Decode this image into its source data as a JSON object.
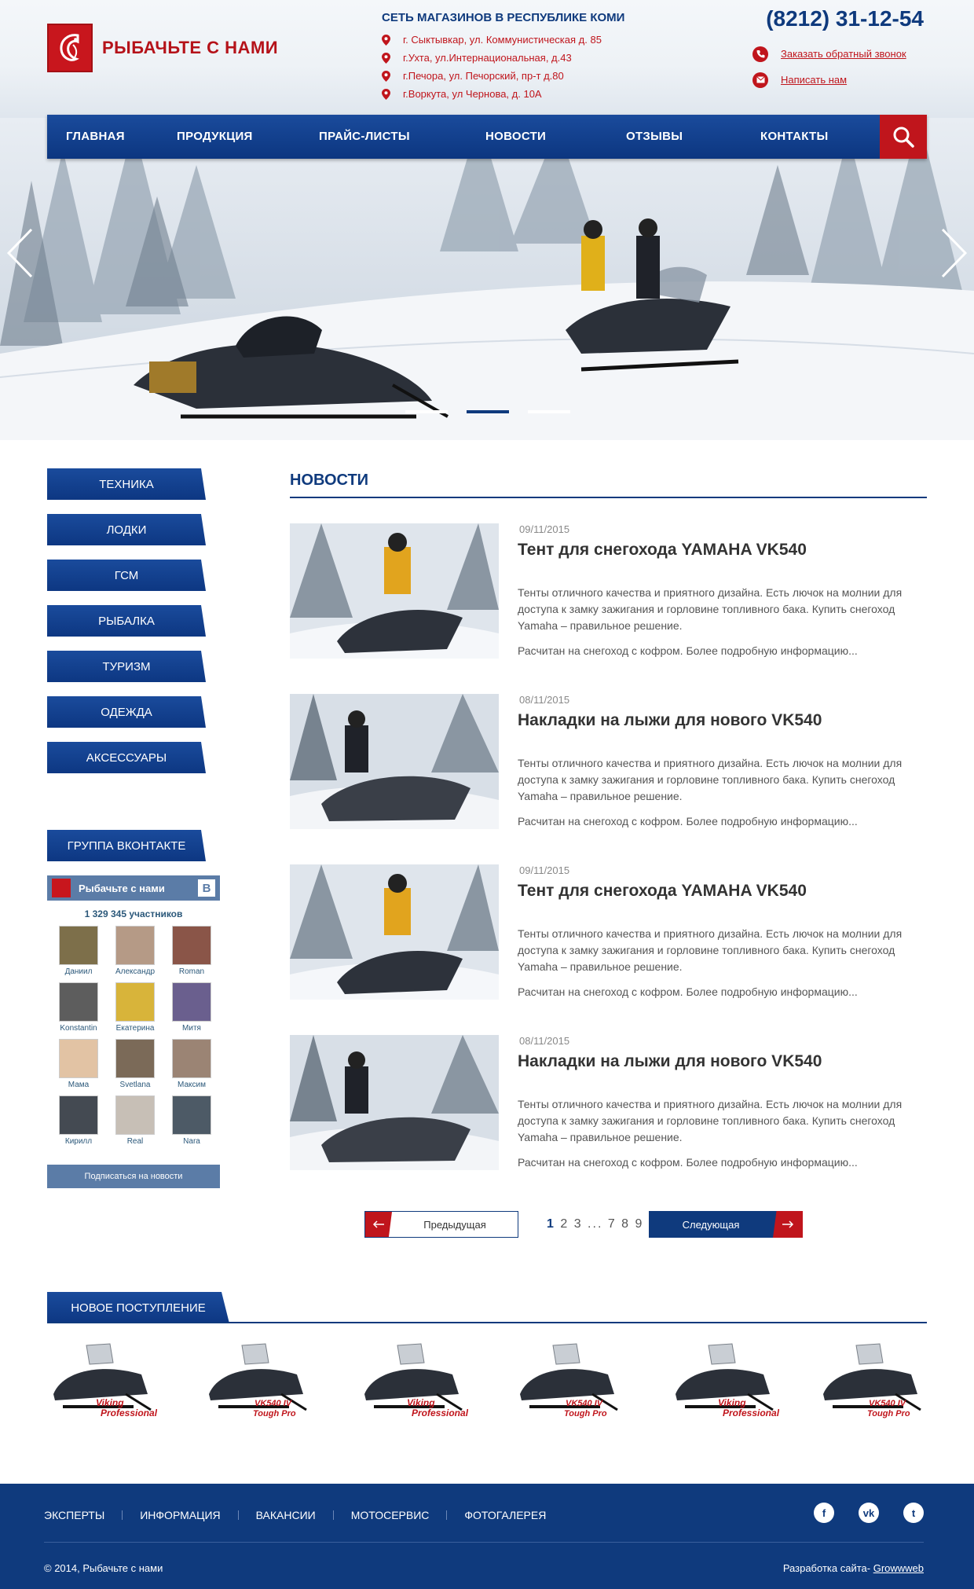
{
  "header": {
    "logo_text": "РЫБАЧЬТЕ С НАМИ",
    "stores_title": "СЕТЬ МАГАЗИНОВ В РЕСПУБЛИКЕ КОМИ",
    "stores": [
      "г. Сыктывкар, ул. Коммунистическая д. 85",
      "г.Ухта, ул.Интернациональная, д.43",
      "г.Печора,  ул. Печорский, пр-т  д.80",
      "г.Воркута,  ул Чернова,  д. 10А"
    ],
    "phone": "(8212) 31-12-54",
    "callback_link": "Заказать обратный звонок",
    "write_link": "Написать нам"
  },
  "nav": {
    "items": [
      "ГЛАВНАЯ",
      "ПРОДУКЦИЯ",
      "ПРАЙС-ЛИСТЫ",
      "НОВОСТИ",
      "ОТЗЫВЫ",
      "КОНТАКТЫ"
    ],
    "search_icon": "search-icon"
  },
  "hero": {
    "slide_count": 3,
    "active_slide": 2
  },
  "sidebar": {
    "categories": [
      "ТЕХНИКА",
      "ЛОДКИ",
      "ГСМ",
      "РЫБАЛКА",
      "ТУРИЗМ",
      "ОДЕЖДА",
      "АКСЕССУАРЫ"
    ],
    "vk_title": "ГРУППА ВКОНТАКТЕ",
    "vk": {
      "group_name": "Рыбачьте с нами",
      "vk_letter": "В",
      "members_count": "1 329 345 участников",
      "members": [
        "Даниил",
        "Александр",
        "Roman",
        "Konstantin",
        "Екатерина",
        "Митя",
        "Мама",
        "Svetlana",
        "Максим",
        "Кирилл",
        "Real",
        "Nara"
      ],
      "subscribe": "Подписаться на новости"
    }
  },
  "news": {
    "title": "НОВОСТИ",
    "items": [
      {
        "date": "09/11/2015",
        "title": "Тент для снегохода YAMAHA VK540",
        "body": "Тенты отличного качества и приятного дизайна. Есть лючок на молнии для доступа к замку зажигания и горловине топливного бака. Купить снегоход Yamaha – правильное решение.",
        "more": "Расчитан на снегоход с кофром. Более подробную информацию..."
      },
      {
        "date": "08/11/2015",
        "title": "Накладки на лыжи для нового VK540",
        "body": "Тенты отличного качества и приятного дизайна. Есть лючок на молнии для доступа к замку зажигания и горловине топливного бака. Купить снегоход Yamaha – правильное решение.",
        "more": "Расчитан на снегоход с кофром. Более подробную информацию..."
      },
      {
        "date": "09/11/2015",
        "title": "Тент для снегохода YAMAHA VK540",
        "body": "Тенты отличного качества и приятного дизайна. Есть лючок на молнии для доступа к замку зажигания и горловине топливного бака. Купить снегоход Yamaha – правильное решение.",
        "more": "Расчитан на снегоход с кофром. Более подробную информацию..."
      },
      {
        "date": "08/11/2015",
        "title": "Накладки на лыжи для нового VK540",
        "body": "Тенты отличного качества и приятного дизайна. Есть лючок на молнии для доступа к замку зажигания и горловине топливного бака. Купить снегоход Yamaha – правильное решение.",
        "more": "Расчитан на снегоход с кофром. Более подробную информацию..."
      }
    ]
  },
  "pagination": {
    "prev": "Предыдущая",
    "current": "1",
    "pages": "2 3 ... 7 8 9",
    "next": "Следующая"
  },
  "new_arrivals": {
    "title": "НОВОЕ ПОСТУПЛЕНИЕ",
    "items": [
      {
        "badge_top": "Viking",
        "badge_bottom": "Professional"
      },
      {
        "badge_top": "VK540 IV",
        "badge_bottom": "Tough Pro"
      },
      {
        "badge_top": "Viking",
        "badge_bottom": "Professional"
      },
      {
        "badge_top": "VK540 IV",
        "badge_bottom": "Tough Pro"
      },
      {
        "badge_top": "Viking",
        "badge_bottom": "Professional"
      },
      {
        "badge_top": "VK540 IV",
        "badge_bottom": "Tough Pro"
      }
    ]
  },
  "footer": {
    "links": [
      "ЭКСПЕРТЫ",
      "ИНФОРМАЦИЯ",
      "ВАКАНСИИ",
      "МОТОСЕРВИС",
      "ФОТОГАЛЕРЕЯ"
    ],
    "social": [
      {
        "icon": "facebook-icon",
        "glyph": "f"
      },
      {
        "icon": "vk-icon",
        "glyph": "vk"
      },
      {
        "icon": "twitter-icon",
        "glyph": "t"
      }
    ],
    "copyright": "© 2014, Рыбачьте с нами",
    "dev_label": "Разработка сайта-",
    "dev_link": "Growwweb"
  },
  "colors": {
    "brand_blue": "#0f3a7d",
    "brand_red": "#c0151c",
    "vk_blue": "#5b7ca7"
  }
}
